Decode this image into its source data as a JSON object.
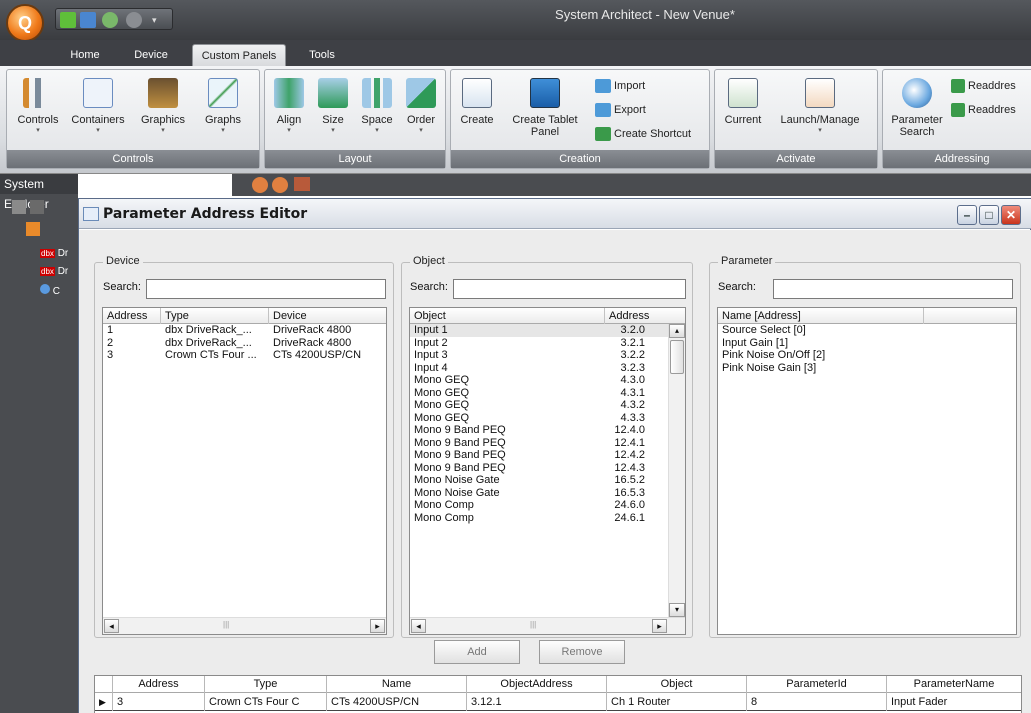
{
  "app": {
    "title": "System Architect - New Venue*",
    "orb_glyph": "Q"
  },
  "tabs": [
    "Home",
    "Device",
    "Custom Panels",
    "Tools"
  ],
  "ribbon": {
    "groups": {
      "controls": {
        "label": "Controls",
        "items": [
          "Controls",
          "Containers",
          "Graphics",
          "Graphs"
        ]
      },
      "layout": {
        "label": "Layout",
        "items": [
          "Align",
          "Size",
          "Space",
          "Order"
        ]
      },
      "creation": {
        "label": "Creation",
        "create": "Create",
        "create_tablet": "Create Tablet",
        "create_tablet_2": "Panel",
        "import": "Import",
        "export": "Export",
        "create_shortcut": "Create Shortcut"
      },
      "activate": {
        "label": "Activate",
        "current": "Current",
        "launch": "Launch/Manage"
      },
      "addressing": {
        "label": "Addressing",
        "param_search": "Parameter",
        "param_search_2": "Search",
        "readdress1": "Readdres",
        "readdress2": "Readdres"
      }
    }
  },
  "system_explorer": {
    "title": "System Explorer",
    "items": [
      "Dr",
      "Dr",
      "C"
    ]
  },
  "editor": {
    "title": "Parameter Address Editor",
    "device": {
      "legend": "Device",
      "search_label": "Search:",
      "search_value": "",
      "columns": [
        "Address",
        "Type",
        "Device"
      ],
      "rows": [
        [
          "1",
          "dbx DriveRack_...",
          "DriveRack 4800"
        ],
        [
          "2",
          "dbx DriveRack_...",
          "DriveRack 4800"
        ],
        [
          "3",
          "Crown CTs Four ...",
          "CTs 4200USP/CN"
        ]
      ]
    },
    "object": {
      "legend": "Object",
      "search_label": "Search:",
      "search_value": "",
      "columns": [
        "Object",
        "Address"
      ],
      "rows": [
        [
          "Input 1",
          "3.2.0"
        ],
        [
          "Input 2",
          "3.2.1"
        ],
        [
          "Input 3",
          "3.2.2"
        ],
        [
          "Input 4",
          "3.2.3"
        ],
        [
          "Mono GEQ",
          "4.3.0"
        ],
        [
          "Mono GEQ",
          "4.3.1"
        ],
        [
          "Mono GEQ",
          "4.3.2"
        ],
        [
          "Mono GEQ",
          "4.3.3"
        ],
        [
          "Mono 9 Band PEQ",
          "12.4.0"
        ],
        [
          "Mono 9 Band PEQ",
          "12.4.1"
        ],
        [
          "Mono 9 Band PEQ",
          "12.4.2"
        ],
        [
          "Mono 9 Band PEQ",
          "12.4.3"
        ],
        [
          "Mono Noise Gate",
          "16.5.2"
        ],
        [
          "Mono Noise Gate",
          "16.5.3"
        ],
        [
          "Mono Comp",
          "24.6.0"
        ],
        [
          "Mono Comp",
          "24.6.1"
        ]
      ]
    },
    "parameter": {
      "legend": "Parameter",
      "search_label": "Search:",
      "search_value": "",
      "columns": [
        "Name [Address]"
      ],
      "rows": [
        "Source Select [0]",
        "Input Gain [1]",
        "Pink Noise On/Off [2]",
        "Pink Noise Gain [3]"
      ]
    },
    "buttons": {
      "add": "Add",
      "remove": "Remove"
    },
    "grid": {
      "columns": [
        "Address",
        "Type",
        "Name",
        "ObjectAddress",
        "Object",
        "ParameterId",
        "ParameterName"
      ],
      "rows": [
        [
          "3",
          "Crown CTs Four C",
          "CTs 4200USP/CN",
          "3.12.1",
          "Ch 1 Router",
          "8",
          "Input Fader"
        ]
      ]
    }
  }
}
